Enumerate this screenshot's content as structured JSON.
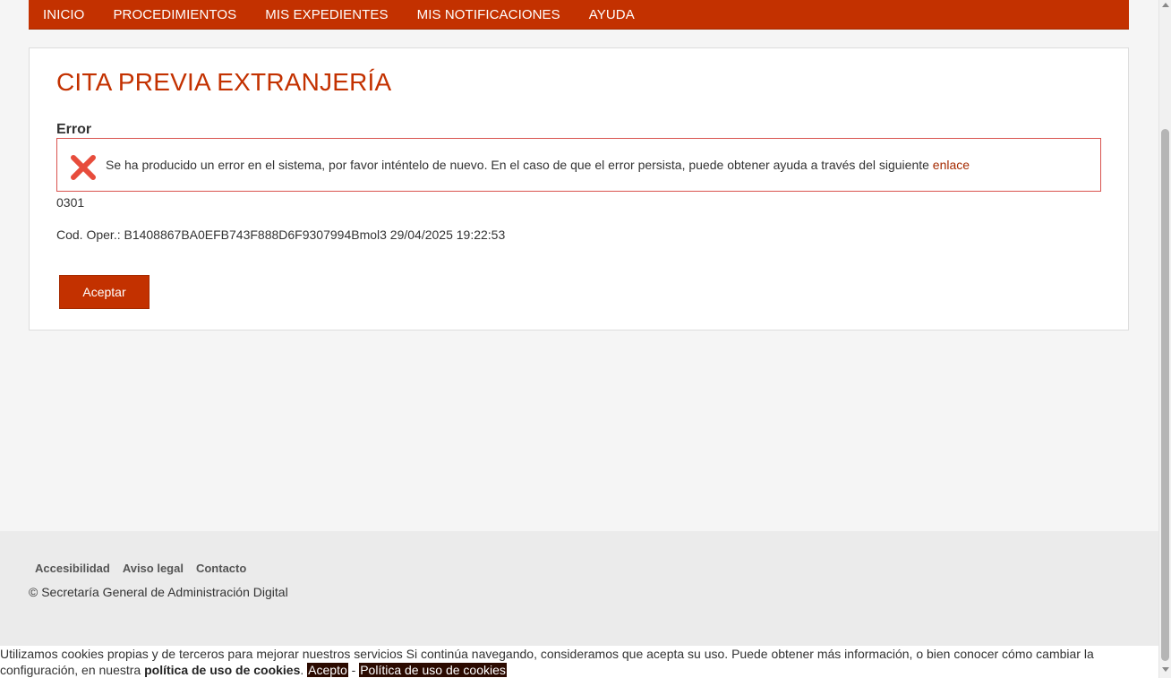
{
  "nav": {
    "items": [
      "INICIO",
      "PROCEDIMIENTOS",
      "MIS EXPEDIENTES",
      "MIS NOTIFICACIONES",
      "AYUDA"
    ]
  },
  "main": {
    "title": "CITA PREVIA EXTRANJERÍA",
    "error_heading": "Error",
    "error_message": "Se ha producido un error en el sistema, por favor inténtelo de nuevo. En el caso de que el error persista, puede obtener ayuda a través del siguiente ",
    "error_link": "enlace",
    "error_code": "0301",
    "cod_oper": "Cod. Oper.: B1408867BA0EFB743F888D6F9307994Bmol3 29/04/2025 19:22:53",
    "accept_label": "Aceptar",
    "error_icon": "close-icon"
  },
  "footer": {
    "links": [
      "Accesibilidad",
      "Aviso legal",
      "Contacto"
    ],
    "copyright": "© Secretaría General de Administración Digital"
  },
  "cookie": {
    "text_part1": "Utilizamos cookies propias y de terceros para mejorar nuestros servicios Si continúa navegando, consideramos que acepta su uso. Puede obtener más información, o bien conocer cómo cambiar la configuración, en nuestra ",
    "bold_text": "política de uso de cookies",
    "text_part2": ". ",
    "accept_label": "Acepto",
    "separator": " - ",
    "policy_label": "Política de uso de cookies"
  },
  "colors": {
    "brand": "#c33100",
    "error_border": "#d9534f",
    "error_icon": "#e74c3c",
    "cookie_button": "#2b0a00"
  }
}
